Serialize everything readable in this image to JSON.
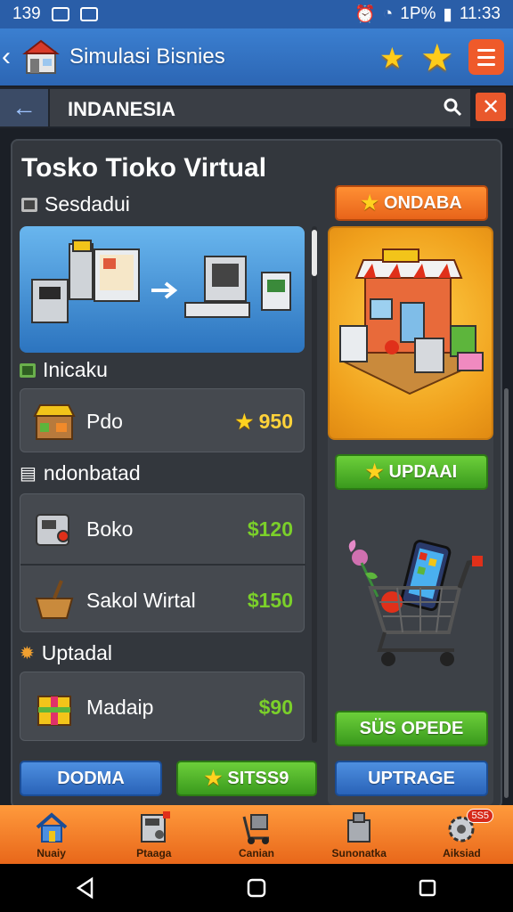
{
  "status": {
    "time_left": "139",
    "battery": "1P%",
    "clock": "11:33"
  },
  "appbar": {
    "title": "Simulasi Bisnies"
  },
  "search": {
    "value": "INDANESIA"
  },
  "main": {
    "title": "Tosko Tioko Virtual",
    "section1": "Sesdadui",
    "section2": "Inicaku",
    "section3": "ndonbatad",
    "section4": "Uptadal",
    "items": [
      {
        "name": "Pdo",
        "price": "950"
      },
      {
        "name": "Boko",
        "price": "$120"
      },
      {
        "name": "Sakol Wirtal",
        "price": "$150"
      },
      {
        "name": "Madaip",
        "price": "$90"
      }
    ],
    "btn_left": "DODMA",
    "btn_mid": "SITSS9"
  },
  "side": {
    "top_btn": "ONDABA",
    "update_btn": "UPDAAI",
    "sus_btn": "SÜS OPEDE",
    "upgrade_btn": "UPTRAGE"
  },
  "nav": {
    "items": [
      {
        "label": "Nuaiy",
        "icon": "home-icon"
      },
      {
        "label": "Ptaaga",
        "icon": "machine-icon"
      },
      {
        "label": "Canian",
        "icon": "cart-dolly-icon"
      },
      {
        "label": "Sunonatka",
        "icon": "box-icon"
      },
      {
        "label": "Aiksiad",
        "icon": "gear-icon",
        "badge": "5S5"
      }
    ]
  },
  "colors": {
    "accent_orange": "#e8671a",
    "appbar_blue": "#2c66b4",
    "price_green": "#7bd02a",
    "price_gold": "#ffd23a"
  }
}
